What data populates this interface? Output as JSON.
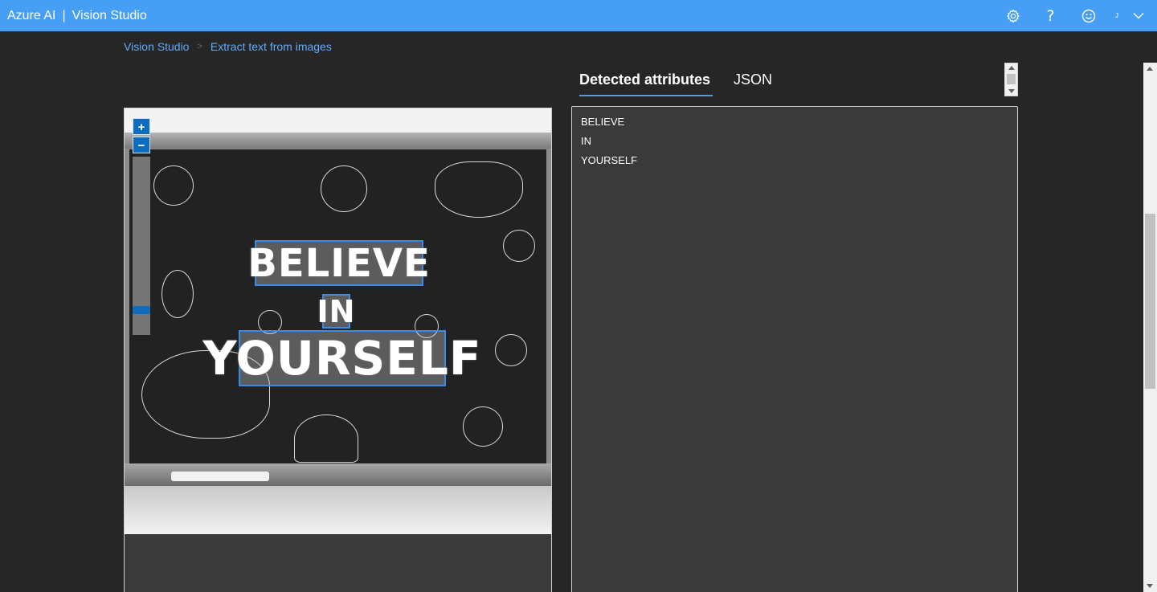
{
  "header": {
    "brand": "Azure AI",
    "separator": "|",
    "product": "Vision Studio",
    "account_initial": "J",
    "icons": [
      "gear-icon",
      "help-icon",
      "feedback-smiley-icon",
      "chevron-down-icon"
    ],
    "accent_color": "#479ef5"
  },
  "breadcrumb": {
    "items": [
      {
        "label": "Vision Studio"
      },
      {
        "label": "Extract text from images"
      }
    ],
    "separator": ">"
  },
  "image_viewer": {
    "zoom_in_label": "+",
    "zoom_out_label": "−",
    "detected_words": [
      "BELIEVE",
      "IN",
      "YOURSELF"
    ],
    "box_color": "#3b8be8"
  },
  "tabs": [
    {
      "label": "Detected attributes",
      "active": true
    },
    {
      "label": "JSON",
      "active": false
    }
  ],
  "results": {
    "lines": [
      "BELIEVE",
      "IN",
      "YOURSELF"
    ]
  }
}
